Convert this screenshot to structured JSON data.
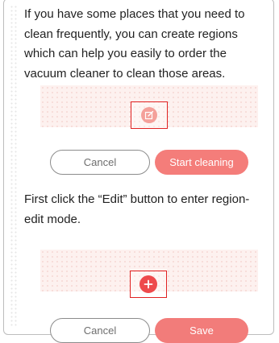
{
  "intro_text": "If you have some places that you need to clean frequently, you can create regions which can help you easily to order the vacuum cleaner to clean those areas.",
  "step1": {
    "cancel_label": "Cancel",
    "start_label": "Start cleaning",
    "highlighted_icon": "edit-icon"
  },
  "instruction_text": "First click the “Edit” button to enter region-edit mode.",
  "step2": {
    "cancel_label": "Cancel",
    "save_label": "Save",
    "highlighted_icon": "plus-icon"
  },
  "colors": {
    "accent": "#f47d7a",
    "highlight_border": "#e02222",
    "map_background": "#fdf1ef"
  }
}
